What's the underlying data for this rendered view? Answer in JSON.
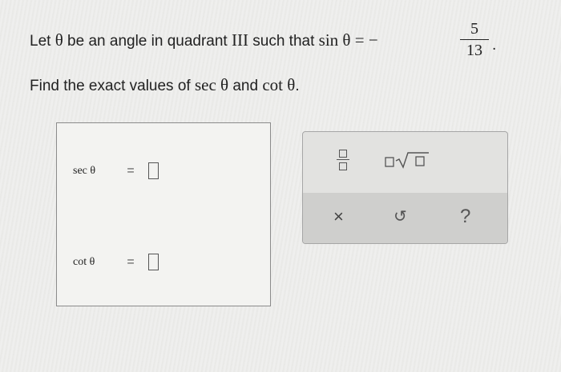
{
  "question": {
    "line1_prefix": "Let",
    "theta": "θ",
    "line1_mid": "be an angle in quadrant",
    "quadrant": "III",
    "line1_suffix": "such that",
    "sin_expr": "sin θ = −",
    "fraction_numerator": "5",
    "fraction_denominator": "13",
    "period": ".",
    "line2_prefix": "Find the exact values of",
    "sec_expr": "sec θ",
    "and_text": "and",
    "cot_expr": "cot θ",
    "line2_end": "."
  },
  "answers": [
    {
      "label": "sec θ",
      "equals": "="
    },
    {
      "label": "cot θ",
      "equals": "="
    }
  ],
  "toolbar": {
    "fraction_icon": "fraction-icon",
    "sqrt_icon": "square-root-icon",
    "clear_symbol": "×",
    "undo_symbol": "↺",
    "help_symbol": "?"
  }
}
